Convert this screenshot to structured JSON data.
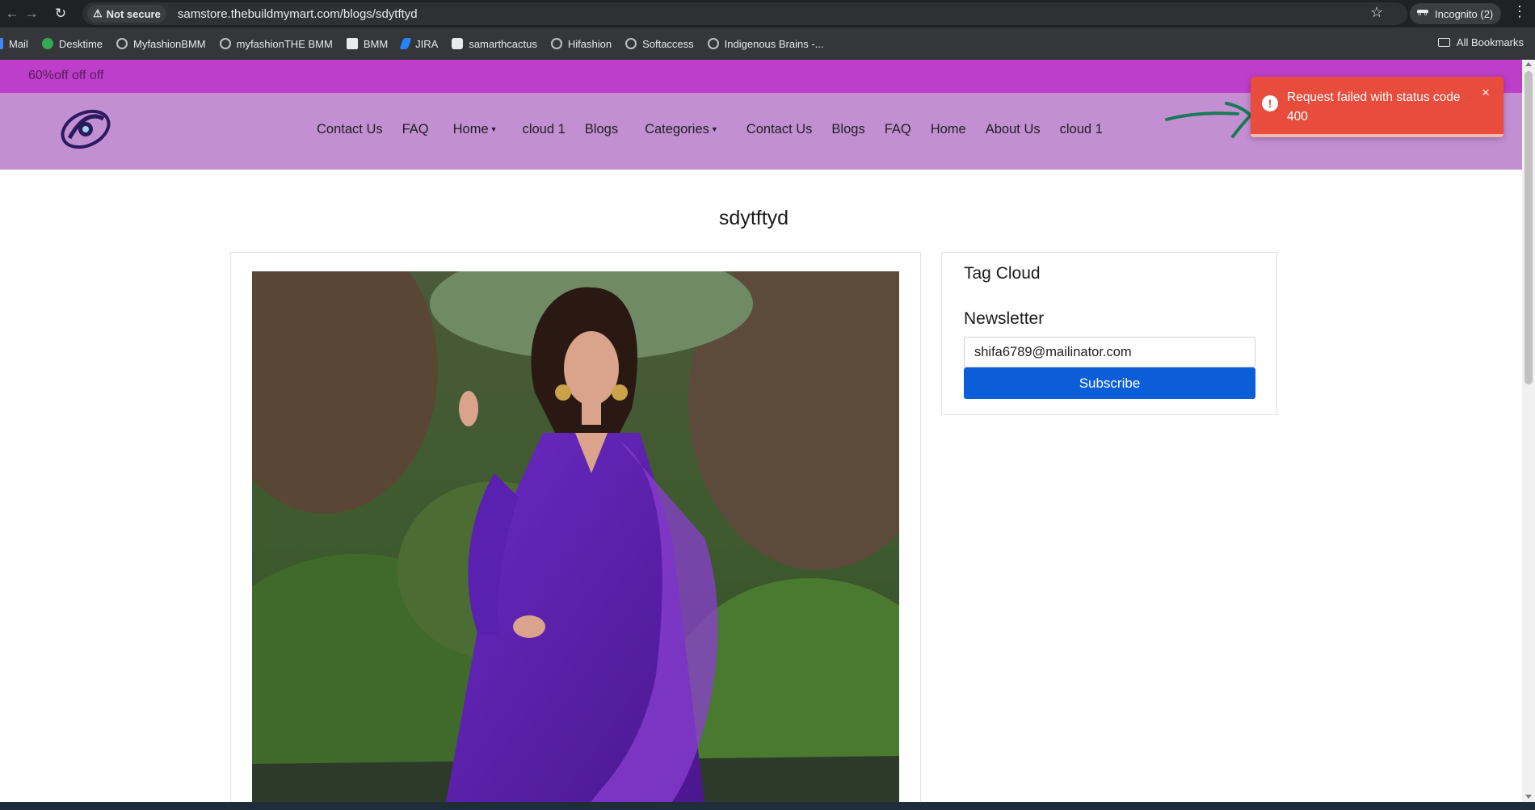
{
  "browser": {
    "security_label": "Not secure",
    "url": "samstore.thebuildmymart.com/blogs/sdytftyd",
    "incognito_label": "Incognito (2)",
    "bookmarks": [
      {
        "label": "Mail",
        "icon": "mail-icon"
      },
      {
        "label": "Desktime",
        "icon": "desktime-icon"
      },
      {
        "label": "MyfashionBMM",
        "icon": "globe-icon"
      },
      {
        "label": "myfashionTHE BMM",
        "icon": "globe-icon"
      },
      {
        "label": "BMM",
        "icon": "bmm-icon"
      },
      {
        "label": "JIRA",
        "icon": "jira-icon"
      },
      {
        "label": "samarthcactus",
        "icon": "cactus-icon"
      },
      {
        "label": "Hifashion",
        "icon": "globe-icon"
      },
      {
        "label": "Softaccess",
        "icon": "globe-icon"
      },
      {
        "label": "Indigenous Brains -...",
        "icon": "globe-icon"
      }
    ],
    "all_bookmarks_label": "All Bookmarks"
  },
  "promo": {
    "text": "60%off off off"
  },
  "nav": {
    "items": [
      {
        "label": "Contact Us",
        "dropdown": false
      },
      {
        "label": "FAQ",
        "dropdown": false
      },
      {
        "label": "Home",
        "dropdown": true
      },
      {
        "label": "cloud 1",
        "dropdown": false
      },
      {
        "label": "Blogs",
        "dropdown": false
      },
      {
        "label": "Categories",
        "dropdown": true
      },
      {
        "label": "Contact Us",
        "dropdown": false
      },
      {
        "label": "Blogs",
        "dropdown": false
      },
      {
        "label": "FAQ",
        "dropdown": false
      },
      {
        "label": "Home",
        "dropdown": false
      },
      {
        "label": "About Us",
        "dropdown": false
      },
      {
        "label": "cloud 1",
        "dropdown": false
      }
    ]
  },
  "toast": {
    "message": "Request failed with status code 400",
    "close_glyph": "×",
    "color": "#e74c3c"
  },
  "post": {
    "title": "sdytftyd",
    "image_description_icon": "blog-post-image"
  },
  "sidebar": {
    "tag_cloud_heading": "Tag Cloud",
    "newsletter_heading": "Newsletter",
    "email_value": "shifa6789@mailinator.com",
    "subscribe_label": "Subscribe"
  },
  "colors": {
    "promo_bar": "#bd3ec8",
    "header": "#c38fd3",
    "subscribe_button": "#0b5ed7",
    "arrow": "#1a7a55"
  }
}
